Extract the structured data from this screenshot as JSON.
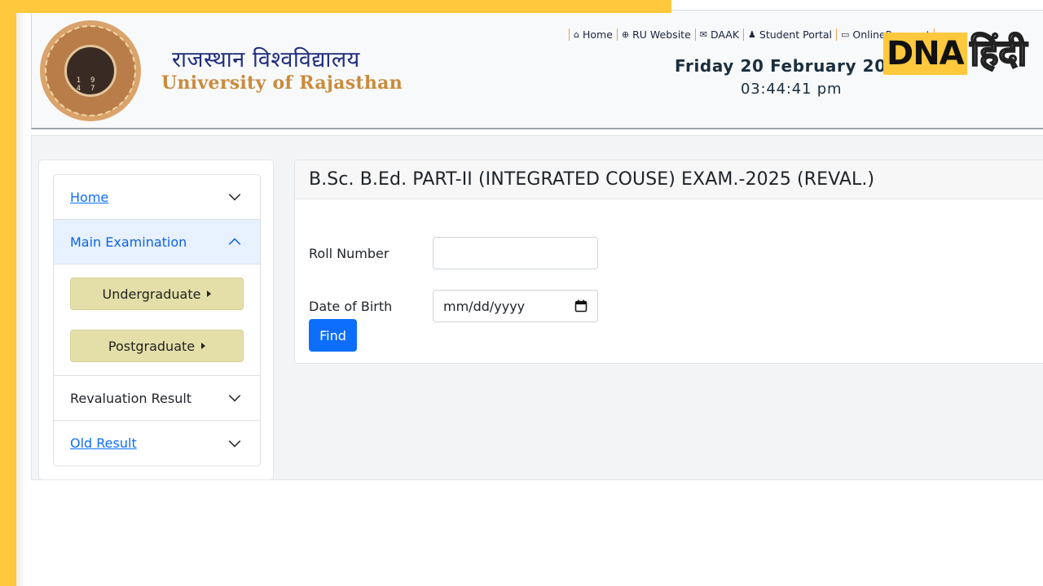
{
  "header": {
    "university_hindi": "राजस्थान विश्वविद्यालय",
    "university_english": "University of Rajasthan",
    "logo_year": "19 47",
    "date": "Friday 20 February 20",
    "time": "03:44:41 pm",
    "nav": [
      {
        "icon": "home-icon",
        "glyph": "⌂",
        "label": "Home"
      },
      {
        "icon": "globe-icon",
        "glyph": "⊕",
        "label": "RU Website"
      },
      {
        "icon": "envelope-icon",
        "glyph": "✉",
        "label": "DAAK"
      },
      {
        "icon": "user-icon",
        "glyph": "♟",
        "label": "Student Portal"
      },
      {
        "icon": "card-icon",
        "glyph": "▭",
        "label": "OnlinePayment"
      }
    ]
  },
  "watermark": {
    "en": "DNA",
    "hi": "हिंदी"
  },
  "sidebar": {
    "items": [
      {
        "label": "Home",
        "link": true
      },
      {
        "label": "Main Examination",
        "expanded": true
      },
      {
        "label": "Revaluation Result",
        "link": false
      },
      {
        "label": "Old Result",
        "link": true
      }
    ],
    "sub_buttons": [
      "Undergraduate",
      "Postgraduate"
    ]
  },
  "form": {
    "title": "B.Sc. B.Ed. PART-II (INTEGRATED COUSE) EXAM.-2025 (REVAL.)",
    "roll_label": "Roll Number",
    "roll_value": "",
    "dob_label": "Date of Birth",
    "dob_placeholder": "mm/dd/yyyy",
    "find_label": "Find"
  },
  "colors": {
    "frame": "#ffc83d",
    "primary": "#0d6efd",
    "accordion_active_bg": "#e7f1ff",
    "level_button_bg": "#e4dfa8",
    "university_english": "#c98b3c",
    "university_hindi": "#1f2e7d"
  }
}
